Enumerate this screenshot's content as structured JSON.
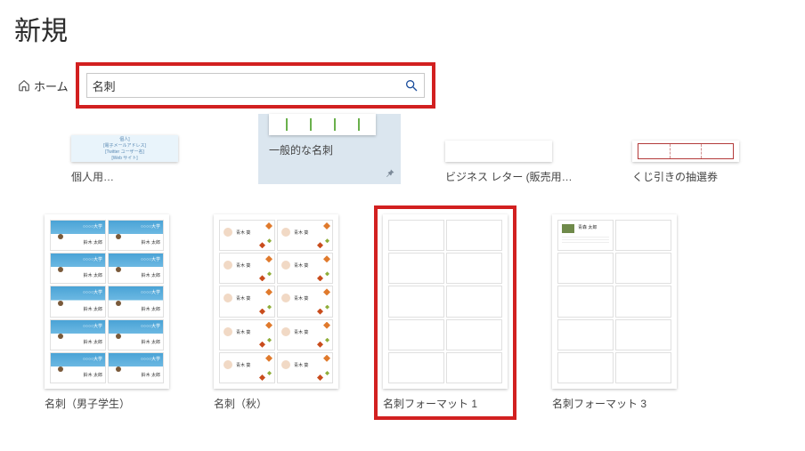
{
  "page_title": "新規",
  "home": {
    "label": "ホーム"
  },
  "search": {
    "value": "名刺"
  },
  "row1": {
    "kojin": {
      "label": "個人用…"
    },
    "ippan": {
      "label": "一般的な名刺"
    },
    "letter": {
      "label": "ビジネス レター (販売用…"
    },
    "kuji": {
      "label": "くじ引きの抽選券"
    }
  },
  "row2": {
    "boy": {
      "label": "名刺（男子学生）",
      "tile_top": "○○○○大学",
      "tile_bottom": "鈴木 太郎"
    },
    "autumn": {
      "label": "名刺（秋）",
      "tile_name": "青木 葵"
    },
    "fmt1": {
      "label": "名刺フォーマット 1"
    },
    "fmt3": {
      "label": "名刺フォーマット 3",
      "tile_name": "青森 太郎"
    }
  }
}
